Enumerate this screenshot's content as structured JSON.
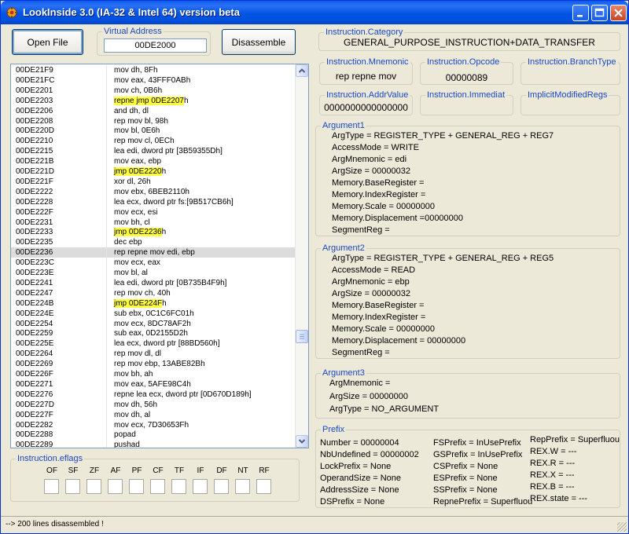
{
  "window": {
    "title": "LookInside 3.0 (IA-32 & Intel 64) version beta"
  },
  "toolbar": {
    "open_file_label": "Open File",
    "virtual_address_label": "Virtual Address",
    "virtual_address_value": "00DE2000",
    "disassemble_label": "Disassemble"
  },
  "disasm": {
    "rows": [
      {
        "addr": "00DE21F9",
        "ins": "mov dh, 8Fh"
      },
      {
        "addr": "00DE21FC",
        "ins": "mov eax, 43FFF0ABh"
      },
      {
        "addr": "00DE2201",
        "ins": "mov ch, 0B6h"
      },
      {
        "addr": "00DE2203",
        "ins_hl": "repne jmp 0DE2207",
        "ins_rest": "h"
      },
      {
        "addr": "00DE2206",
        "ins": "and dh, dl"
      },
      {
        "addr": "00DE2208",
        "ins": "rep mov bl, 98h"
      },
      {
        "addr": "00DE220D",
        "ins": "mov bl, 0E6h"
      },
      {
        "addr": "00DE2210",
        "ins": "rep mov cl, 0ECh"
      },
      {
        "addr": "00DE2215",
        "ins": "lea edi, dword ptr [3B59355Dh]"
      },
      {
        "addr": "00DE221B",
        "ins": "mov eax, ebp"
      },
      {
        "addr": "00DE221D",
        "ins_hl": "jmp 0DE2220",
        "ins_rest": "h"
      },
      {
        "addr": "00DE221F",
        "ins": "xor dl, 26h"
      },
      {
        "addr": "00DE2222",
        "ins": "mov ebx, 6BEB2110h"
      },
      {
        "addr": "00DE2228",
        "ins": "lea ecx, dword ptr fs:[9B517CB6h]"
      },
      {
        "addr": "00DE222F",
        "ins": "mov ecx, esi"
      },
      {
        "addr": "00DE2231",
        "ins": "mov bh, cl"
      },
      {
        "addr": "00DE2233",
        "ins_hl": "jmp 0DE2236",
        "ins_rest": "h"
      },
      {
        "addr": "00DE2235",
        "ins": "dec ebp"
      },
      {
        "addr": "00DE2236",
        "ins": "rep repne mov edi, ebp",
        "selected": true
      },
      {
        "addr": "00DE223C",
        "ins": "mov ecx, eax"
      },
      {
        "addr": "00DE223E",
        "ins": "mov bl, al"
      },
      {
        "addr": "00DE2241",
        "ins": "lea edi, dword ptr [0B735B4F9h]"
      },
      {
        "addr": "00DE2247",
        "ins": "rep mov ch, 40h"
      },
      {
        "addr": "00DE224B",
        "ins_hl": "jmp 0DE224F",
        "ins_rest": "h"
      },
      {
        "addr": "00DE224E",
        "ins": "sub ebx, 0C1C6FC01h"
      },
      {
        "addr": "00DE2254",
        "ins": "mov ecx, 8DC78AF2h"
      },
      {
        "addr": "00DE2259",
        "ins": "sub eax, 0D2155D2h"
      },
      {
        "addr": "00DE225E",
        "ins": "lea ecx, dword ptr [88BD560h]"
      },
      {
        "addr": "00DE2264",
        "ins": "rep mov dl, dl"
      },
      {
        "addr": "00DE2269",
        "ins": "rep mov ebp, 13ABE82Bh"
      },
      {
        "addr": "00DE226F",
        "ins": "mov bh, ah"
      },
      {
        "addr": "00DE2271",
        "ins": "mov eax, 5AFE98C4h"
      },
      {
        "addr": "00DE2276",
        "ins": "repne lea ecx, dword ptr [0D670D189h]"
      },
      {
        "addr": "00DE227D",
        "ins": "mov dh, 56h"
      },
      {
        "addr": "00DE227F",
        "ins": "mov dh, al"
      },
      {
        "addr": "00DE2282",
        "ins": "mov ecx, 7D30653Fh"
      },
      {
        "addr": "00DE2288",
        "ins": "popad"
      },
      {
        "addr": "00DE2289",
        "ins": "pushad"
      }
    ]
  },
  "eflags": {
    "label": "Instruction.eflags",
    "flags": [
      "OF",
      "SF",
      "ZF",
      "AF",
      "PF",
      "CF",
      "TF",
      "IF",
      "DF",
      "NT",
      "RF"
    ]
  },
  "instruction": {
    "category_label": "Instruction.Category",
    "category_value": "GENERAL_PURPOSE_INSTRUCTION+DATA_TRANSFER",
    "mnemonic_label": "Instruction.Mnemonic",
    "mnemonic_value": "rep repne mov",
    "opcode_label": "Instruction.Opcode",
    "opcode_value": "00000089",
    "branchtype_label": "Instruction.BranchType",
    "branchtype_value": "",
    "addrvalue_label": "Instruction.AddrValue",
    "addrvalue_value": "0000000000000000",
    "immediat_label": "Instruction.Immediat",
    "immediat_value": "",
    "implicit_label": "ImplicitModifiedRegs",
    "implicit_value": ""
  },
  "argument1": {
    "label": "Argument1",
    "lines": [
      "ArgType =  REGISTER_TYPE + GENERAL_REG + REG7",
      "AccessMode = WRITE",
      "ArgMnemonic =  edi",
      "ArgSize =  00000032",
      "Memory.BaseRegister =",
      "Memory.IndexRegister =",
      "Memory.Scale =   00000000",
      "Memory.Displacement =00000000",
      "SegmentReg ="
    ]
  },
  "argument2": {
    "label": "Argument2",
    "lines": [
      "ArgType =     REGISTER_TYPE + GENERAL_REG + REG5",
      "AccessMode =  READ",
      "ArgMnemonic =  ebp",
      "ArgSize =   00000032",
      "Memory.BaseRegister =",
      "Memory.IndexRegister =",
      "Memory.Scale = 00000000",
      "Memory.Displacement = 00000000",
      "SegmentReg ="
    ]
  },
  "argument3": {
    "label": "Argument3",
    "lines": [
      "ArgMnemonic =",
      "ArgSize =    00000000",
      "ArgType = NO_ARGUMENT"
    ]
  },
  "prefix": {
    "label": "Prefix",
    "col1": [
      "Number = 00000004",
      "NbUndefined = 00000002",
      "LockPrefix = None",
      "OperandSize = None",
      "AddressSize = None",
      "DSPrefix = None"
    ],
    "col2": [
      "FSPrefix =  InUsePrefix",
      "GSPrefix = InUsePrefix",
      "CSPrefix = None",
      "ESPrefix = None",
      "SSPrefix = None",
      "RepnePrefix = Superfluou"
    ],
    "col3": [
      "RepPrefix = Superfluou",
      "REX.W =  ---",
      "REX.R = ---",
      "REX.X = ---",
      "REX.B = ---",
      "REX.state = ---"
    ]
  },
  "status": {
    "text": "--> 200 lines disassembled !"
  }
}
